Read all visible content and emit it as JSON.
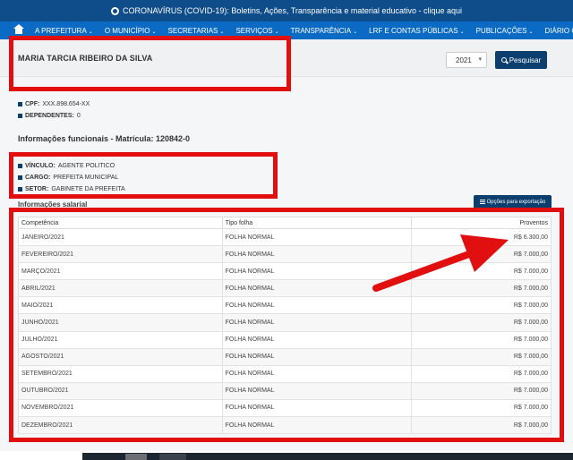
{
  "alert": {
    "text": "CORONAVÍRUS (COVID-19): Boletins, Ações, Transparência e material educativo - clique aqui"
  },
  "nav": {
    "home_icon": "home-icon",
    "items": [
      {
        "label": "A PREFEITURA",
        "caret": "⌄"
      },
      {
        "label": "O MUNICÍPIO",
        "caret": "⌄"
      },
      {
        "label": "SECRETARIAS",
        "caret": "⌄"
      },
      {
        "label": "SERVIÇOS",
        "caret": "⌄"
      },
      {
        "label": "TRANSPARÊNCIA",
        "caret": "⌄"
      },
      {
        "label": "LRF E CONTAS PÚBLICAS",
        "caret": "⌄"
      },
      {
        "label": "PUBLICAÇÕES",
        "caret": "⌄"
      },
      {
        "label": "DIÁRIO OFICIAL",
        "caret": ""
      }
    ]
  },
  "header": {
    "name": "MARIA TARCIA RIBEIRO DA SILVA",
    "year_value": "2021",
    "search_label": "Pesquisar"
  },
  "personal": {
    "cpf_label": "CPF:",
    "cpf_value": "XXX.898.654-XX",
    "dependents_label": "DEPENDENTES:",
    "dependents_value": "0"
  },
  "functional": {
    "title": "Informações funcionais - Matrícula: 120842-0",
    "vinculo_label": "VÍNCULO:",
    "vinculo_value": "AGENTE POLITICO",
    "cargo_label": "CARGO:",
    "cargo_value": "PREFEITA MUNICIPAL",
    "setor_label": "SETOR:",
    "setor_value": "GABINETE DA PREFEITA"
  },
  "salary": {
    "title": "Informações salarial",
    "export_label": "Opções para exportação",
    "columns": [
      "Competência",
      "Tipo folha",
      "Proventos"
    ],
    "rows": [
      [
        "JANEIRO/2021",
        "FOLHA NORMAL",
        "R$ 6.300,00"
      ],
      [
        "FEVEREIRO/2021",
        "FOLHA NORMAL",
        "R$ 7.000,00"
      ],
      [
        "MARÇO/2021",
        "FOLHA NORMAL",
        "R$ 7.000,00"
      ],
      [
        "ABRIL/2021",
        "FOLHA NORMAL",
        "R$ 7.000,00"
      ],
      [
        "MAIO/2021",
        "FOLHA NORMAL",
        "R$ 7.000,00"
      ],
      [
        "JUNHO/2021",
        "FOLHA NORMAL",
        "R$ 7.000,00"
      ],
      [
        "JULHO/2021",
        "FOLHA NORMAL",
        "R$ 7.000,00"
      ],
      [
        "AGOSTO/2021",
        "FOLHA NORMAL",
        "R$ 7.000,00"
      ],
      [
        "SETEMBRO/2021",
        "FOLHA NORMAL",
        "R$ 7.000,00"
      ],
      [
        "OUTUBRO/2021",
        "FOLHA NORMAL",
        "R$ 7.000,00"
      ],
      [
        "NOVEMBRO/2021",
        "FOLHA NORMAL",
        "R$ 7.000,00"
      ],
      [
        "DEZEMBRO/2021",
        "FOLHA NORMAL",
        "R$ 7.000,00"
      ]
    ]
  },
  "colors": {
    "alert_bg": "#0f4c8a",
    "nav_bg": "#0b6bc4",
    "button_bg": "#0d3f6e",
    "annotation_red": "#e10f0f"
  }
}
